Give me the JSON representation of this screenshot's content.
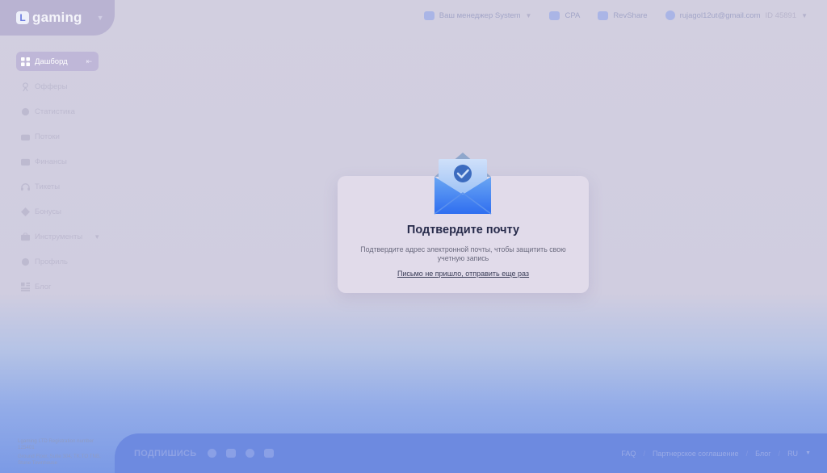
{
  "brand": {
    "logo_letter": "L",
    "name": "gaming"
  },
  "sidebar": {
    "items": [
      {
        "label": "Дашборд",
        "icon": "dashboard-icon",
        "active": true,
        "pin": "pin-icon"
      },
      {
        "label": "Офферы",
        "icon": "offers-icon"
      },
      {
        "label": "Статистика",
        "icon": "statistics-icon"
      },
      {
        "label": "Потоки",
        "icon": "flows-icon"
      },
      {
        "label": "Финансы",
        "icon": "finance-icon"
      },
      {
        "label": "Тикеты",
        "icon": "tickets-icon"
      },
      {
        "label": "Бонусы",
        "icon": "bonus-icon"
      },
      {
        "label": "Инструменты",
        "icon": "tools-icon",
        "has_chevron": true
      },
      {
        "label": "Профиль",
        "icon": "profile-icon"
      },
      {
        "label": "Блог",
        "icon": "blog-icon"
      }
    ],
    "legal": [
      "Lgaming LTD Registration number 125401",
      "Ground Floor, Suite 304, TK.TO TNB, Stone Townhouse"
    ]
  },
  "header": {
    "manager_label": "Ваш менеджер System",
    "cpa_label": "CPA",
    "revshare_label": "RevShare",
    "email": "rujagol12ut@gmail.com",
    "user_id": "ID 45891"
  },
  "modal": {
    "title": "Подтвердите почту",
    "text": "Подтвердите адрес электронной почты, чтобы защитить свою учетную запись",
    "resend_link": "Письмо не пришло, отправить еще раз"
  },
  "footer": {
    "subscribe_label": "ПОДПИШИСЬ",
    "links": [
      "FAQ",
      "Партнерское соглашение",
      "Блог"
    ],
    "separator": "/",
    "language": "RU"
  },
  "colors": {
    "accent": "#6d8ae0",
    "envelope": "#3f84f0",
    "modal_bg": "#e1dbea",
    "title": "#262a4a"
  }
}
